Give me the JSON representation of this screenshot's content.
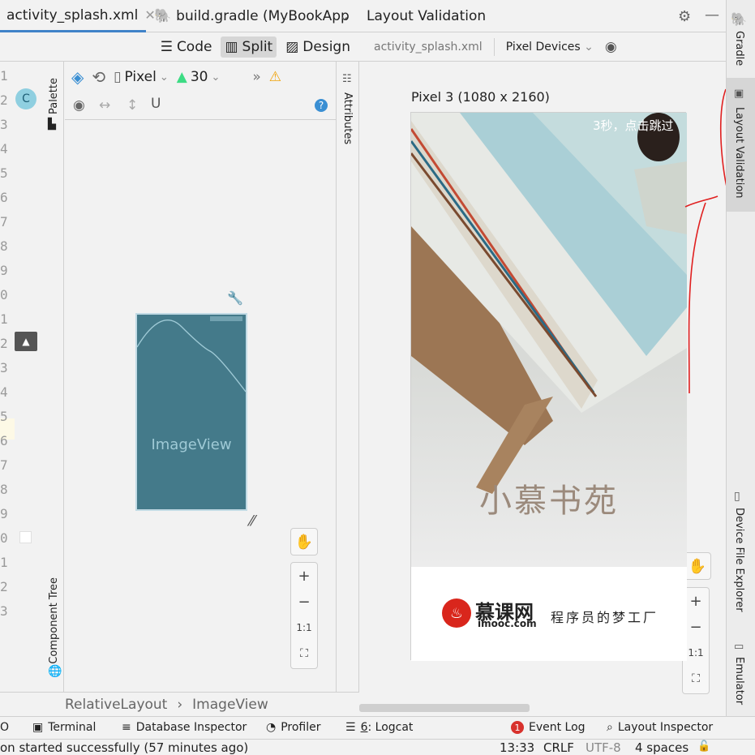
{
  "tabs": [
    {
      "label": "activity_splash.xml",
      "active": true
    },
    {
      "label": "build.gradle (MyBookApp",
      "active": false
    }
  ],
  "view_modes": {
    "code": "Code",
    "split": "Split",
    "design": "Design"
  },
  "line_numbers": [
    "1",
    "2",
    "3",
    "4",
    "5",
    "6",
    "7",
    "8",
    "9",
    "0",
    "1",
    "2",
    "3",
    "4",
    "5",
    "6",
    "7",
    "8",
    "9",
    "0",
    "1",
    "2",
    "3"
  ],
  "gutter_badge": "C",
  "side_labels": {
    "palette": "Palette",
    "component_tree": "Component Tree",
    "attributes": "Attributes"
  },
  "design_toolbar": {
    "device": "Pixel",
    "api": "30"
  },
  "preview": {
    "label": "ImageView"
  },
  "breadcrumb": [
    "RelativeLayout",
    "ImageView"
  ],
  "validation": {
    "title": "Layout Validation",
    "file": "activity_splash.xml",
    "devices": "Pixel Devices",
    "device_label": "Pixel 3 (1080 x 2160)",
    "skip_text": "3秒，点击跳过",
    "app_title": "小慕书苑",
    "logo_text": "慕课网",
    "logo_sub": "imooc.com",
    "slogan": "程序员的梦工厂"
  },
  "zoom": {
    "plus": "+",
    "minus": "−",
    "one_to_one": "1:1"
  },
  "right_tools": {
    "gradle": "Gradle",
    "layout_validation": "Layout Validation",
    "device_explorer": "Device File Explorer",
    "emulator": "Emulator"
  },
  "bottom_tools": {
    "todo": "O",
    "terminal": "Terminal",
    "database": "Database Inspector",
    "profiler": "Profiler",
    "logcat_num": "6",
    "logcat": ": Logcat",
    "event_badge": "1",
    "event_log": "Event Log",
    "layout_inspector": "Layout Inspector"
  },
  "status": {
    "message": "on started successfully (57 minutes ago)",
    "time": "13:33",
    "line_sep": "CRLF",
    "encoding": "UTF-8",
    "indent": "4 spaces"
  },
  "colors": {
    "accent": "#4083c9",
    "preview_bg": "#447a8a",
    "warning": "#f0a30a",
    "annotation": "#e02020",
    "logo_red": "#d9261c"
  }
}
